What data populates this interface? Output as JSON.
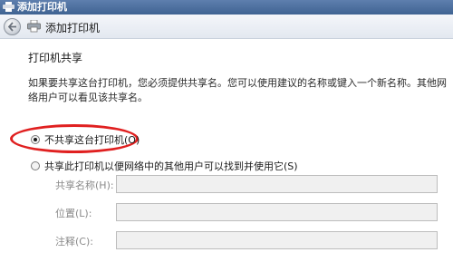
{
  "window": {
    "title": "添加打印机"
  },
  "nav": {
    "title": "添加打印机"
  },
  "section": {
    "title": "打印机共享",
    "description": "如果要共享这台打印机，您必须提供共享名。您可以使用建议的名称或键入一个新名称。其他网络用户可以看见该共享名。"
  },
  "options": {
    "no_share": {
      "label": "不共享这台打印机(O)",
      "checked": true
    },
    "share": {
      "label": "共享此打印机以便网络中的其他用户可以找到并使用它(S)",
      "checked": false
    }
  },
  "fields": {
    "share_name": {
      "label": "共享名称(H):",
      "value": ""
    },
    "location": {
      "label": "位置(L):",
      "value": ""
    },
    "comment": {
      "label": "注释(C):",
      "value": ""
    }
  },
  "colors": {
    "highlight": "#e02020",
    "titlebar": "#3f6392"
  }
}
